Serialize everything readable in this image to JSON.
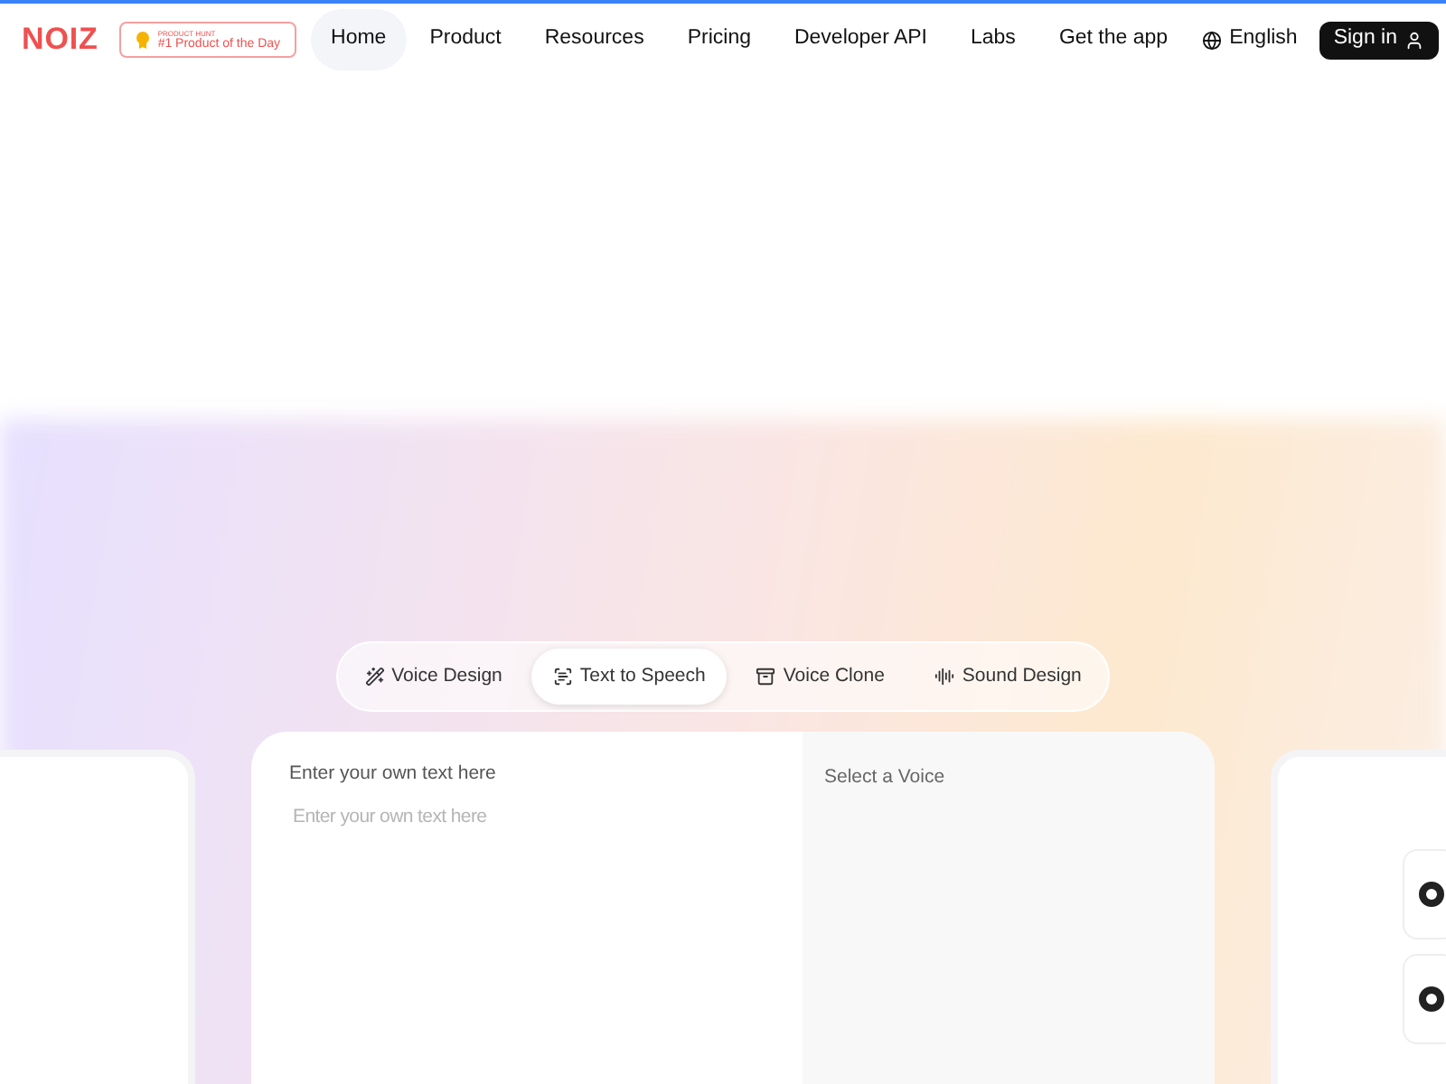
{
  "header": {
    "logo": "NOIZ",
    "badge": {
      "overline": "PRODUCT HUNT",
      "title": "#1 Product of the Day"
    },
    "nav": [
      {
        "label": "Home",
        "selected": true
      },
      {
        "label": "Product",
        "selected": false
      },
      {
        "label": "Resources",
        "selected": false
      },
      {
        "label": "Pricing",
        "selected": false
      },
      {
        "label": "Developer API",
        "selected": false
      },
      {
        "label": "Labs",
        "selected": false
      },
      {
        "label": "Get the app",
        "selected": false
      }
    ],
    "language": "English",
    "sign_in": "Sign in"
  },
  "tabs": [
    {
      "label": "Voice Design",
      "kind": "wand",
      "selected": false
    },
    {
      "label": "Text to Speech",
      "kind": "tts",
      "selected": true
    },
    {
      "label": "Voice Clone",
      "kind": "clone",
      "selected": false
    },
    {
      "label": "Sound Design",
      "kind": "sound",
      "selected": false
    }
  ],
  "editor": {
    "label": "Enter your own text here",
    "placeholder": "Enter your own text here",
    "voice_label": "Select a Voice"
  }
}
